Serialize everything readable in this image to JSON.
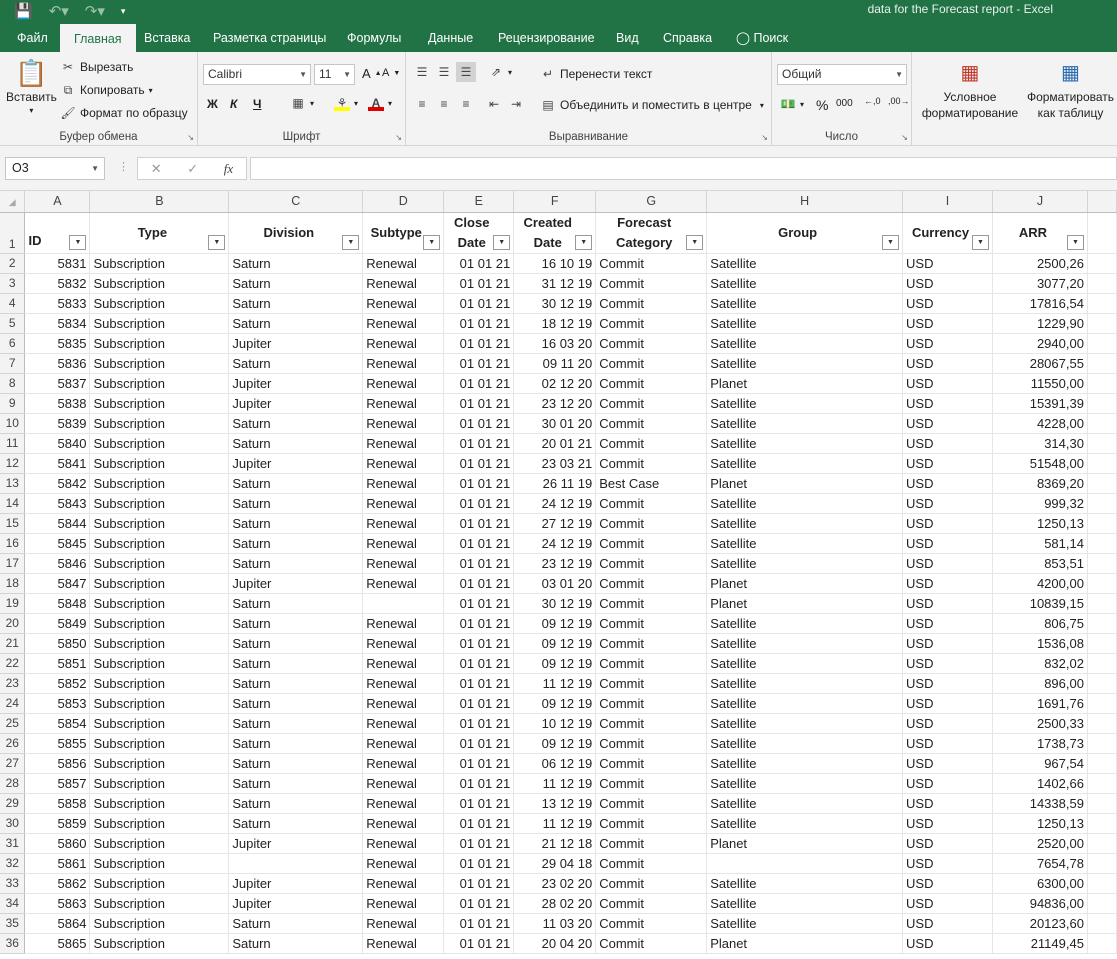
{
  "titlebar": {
    "save_icon": "save-icon",
    "undo_icon": "undo-icon",
    "redo_icon": "redo-icon",
    "title": "data for the Forecast report  -  Excel"
  },
  "tabs": [
    "Файл",
    "Главная",
    "Вставка",
    "Разметка страницы",
    "Формулы",
    "Данные",
    "Рецензирование",
    "Вид",
    "Справка",
    "Поиск"
  ],
  "ribbon": {
    "clipboard": {
      "paste": "Вставить",
      "cut": "Вырезать",
      "copy": "Копировать",
      "format_painter": "Формат по образцу",
      "label": "Буфер обмена"
    },
    "font": {
      "name": "Calibri",
      "size": "11",
      "bold": "Ж",
      "italic": "К",
      "underline": "Ч",
      "label": "Шрифт"
    },
    "alignment": {
      "wrap": "Перенести текст",
      "merge": "Объединить и поместить в центре",
      "label": "Выравнивание"
    },
    "number": {
      "format": "Общий",
      "percent": "%",
      "thousands": "000",
      "label": "Число"
    },
    "styles": {
      "conditional": "Условное форматирование",
      "table": "Форматировать как таблицу"
    }
  },
  "formula_bar": {
    "name_box": "O3",
    "cancel": "✕",
    "enter": "✓",
    "fx": "fx",
    "value": ""
  },
  "columns": [
    "A",
    "B",
    "C",
    "D",
    "E",
    "F",
    "G",
    "H",
    "I",
    "J"
  ],
  "headers": {
    "A": "ID",
    "B": "Type",
    "C": "Division",
    "D": "Subtype",
    "E1": "Close",
    "E2": "Date",
    "F1": "Created",
    "F2": "Date",
    "G1": "Forecast",
    "G2": "Category",
    "H": "Group",
    "I": "Currency",
    "J": "ARR"
  },
  "rows": [
    [
      "2",
      "5831",
      "Subscription",
      "Saturn",
      "Renewal",
      "01 01 21",
      "16 10 19",
      "Commit",
      "Satellite",
      "USD",
      "2500,26"
    ],
    [
      "3",
      "5832",
      "Subscription",
      "Saturn",
      "Renewal",
      "01 01 21",
      "31 12 19",
      "Commit",
      "Satellite",
      "USD",
      "3077,20"
    ],
    [
      "4",
      "5833",
      "Subscription",
      "Saturn",
      "Renewal",
      "01 01 21",
      "30 12 19",
      "Commit",
      "Satellite",
      "USD",
      "17816,54"
    ],
    [
      "5",
      "5834",
      "Subscription",
      "Saturn",
      "Renewal",
      "01 01 21",
      "18 12 19",
      "Commit",
      "Satellite",
      "USD",
      "1229,90"
    ],
    [
      "6",
      "5835",
      "Subscription",
      "Jupiter",
      "Renewal",
      "01 01 21",
      "16 03 20",
      "Commit",
      "Satellite",
      "USD",
      "2940,00"
    ],
    [
      "7",
      "5836",
      "Subscription",
      "Saturn",
      "Renewal",
      "01 01 21",
      "09 11 20",
      "Commit",
      "Satellite",
      "USD",
      "28067,55"
    ],
    [
      "8",
      "5837",
      "Subscription",
      "Jupiter",
      "Renewal",
      "01 01 21",
      "02 12 20",
      "Commit",
      "Planet",
      "USD",
      "11550,00"
    ],
    [
      "9",
      "5838",
      "Subscription",
      "Jupiter",
      "Renewal",
      "01 01 21",
      "23 12 20",
      "Commit",
      "Satellite",
      "USD",
      "15391,39"
    ],
    [
      "10",
      "5839",
      "Subscription",
      "Saturn",
      "Renewal",
      "01 01 21",
      "30 01 20",
      "Commit",
      "Satellite",
      "USD",
      "4228,00"
    ],
    [
      "11",
      "5840",
      "Subscription",
      "Saturn",
      "Renewal",
      "01 01 21",
      "20 01 21",
      "Commit",
      "Satellite",
      "USD",
      "314,30"
    ],
    [
      "12",
      "5841",
      "Subscription",
      "Jupiter",
      "Renewal",
      "01 01 21",
      "23 03 21",
      "Commit",
      "Satellite",
      "USD",
      "51548,00"
    ],
    [
      "13",
      "5842",
      "Subscription",
      "Saturn",
      "Renewal",
      "01 01 21",
      "26 11 19",
      "Best Case",
      "Planet",
      "USD",
      "8369,20"
    ],
    [
      "14",
      "5843",
      "Subscription",
      "Saturn",
      "Renewal",
      "01 01 21",
      "24 12 19",
      "Commit",
      "Satellite",
      "USD",
      "999,32"
    ],
    [
      "15",
      "5844",
      "Subscription",
      "Saturn",
      "Renewal",
      "01 01 21",
      "27 12 19",
      "Commit",
      "Satellite",
      "USD",
      "1250,13"
    ],
    [
      "16",
      "5845",
      "Subscription",
      "Saturn",
      "Renewal",
      "01 01 21",
      "24 12 19",
      "Commit",
      "Satellite",
      "USD",
      "581,14"
    ],
    [
      "17",
      "5846",
      "Subscription",
      "Saturn",
      "Renewal",
      "01 01 21",
      "23 12 19",
      "Commit",
      "Satellite",
      "USD",
      "853,51"
    ],
    [
      "18",
      "5847",
      "Subscription",
      "Jupiter",
      "Renewal",
      "01 01 21",
      "03 01 20",
      "Commit",
      "Planet",
      "USD",
      "4200,00"
    ],
    [
      "19",
      "5848",
      "Subscription",
      "Saturn",
      "",
      "01 01 21",
      "30 12 19",
      "Commit",
      "Planet",
      "USD",
      "10839,15"
    ],
    [
      "20",
      "5849",
      "Subscription",
      "Saturn",
      "Renewal",
      "01 01 21",
      "09 12 19",
      "Commit",
      "Satellite",
      "USD",
      "806,75"
    ],
    [
      "21",
      "5850",
      "Subscription",
      "Saturn",
      "Renewal",
      "01 01 21",
      "09 12 19",
      "Commit",
      "Satellite",
      "USD",
      "1536,08"
    ],
    [
      "22",
      "5851",
      "Subscription",
      "Saturn",
      "Renewal",
      "01 01 21",
      "09 12 19",
      "Commit",
      "Satellite",
      "USD",
      "832,02"
    ],
    [
      "23",
      "5852",
      "Subscription",
      "Saturn",
      "Renewal",
      "01 01 21",
      "11 12 19",
      "Commit",
      "Satellite",
      "USD",
      "896,00"
    ],
    [
      "24",
      "5853",
      "Subscription",
      "Saturn",
      "Renewal",
      "01 01 21",
      "09 12 19",
      "Commit",
      "Satellite",
      "USD",
      "1691,76"
    ],
    [
      "25",
      "5854",
      "Subscription",
      "Saturn",
      "Renewal",
      "01 01 21",
      "10 12 19",
      "Commit",
      "Satellite",
      "USD",
      "2500,33"
    ],
    [
      "26",
      "5855",
      "Subscription",
      "Saturn",
      "Renewal",
      "01 01 21",
      "09 12 19",
      "Commit",
      "Satellite",
      "USD",
      "1738,73"
    ],
    [
      "27",
      "5856",
      "Subscription",
      "Saturn",
      "Renewal",
      "01 01 21",
      "06 12 19",
      "Commit",
      "Satellite",
      "USD",
      "967,54"
    ],
    [
      "28",
      "5857",
      "Subscription",
      "Saturn",
      "Renewal",
      "01 01 21",
      "11 12 19",
      "Commit",
      "Satellite",
      "USD",
      "1402,66"
    ],
    [
      "29",
      "5858",
      "Subscription",
      "Saturn",
      "Renewal",
      "01 01 21",
      "13 12 19",
      "Commit",
      "Satellite",
      "USD",
      "14338,59"
    ],
    [
      "30",
      "5859",
      "Subscription",
      "Saturn",
      "Renewal",
      "01 01 21",
      "11 12 19",
      "Commit",
      "Satellite",
      "USD",
      "1250,13"
    ],
    [
      "31",
      "5860",
      "Subscription",
      "Jupiter",
      "Renewal",
      "01 01 21",
      "21 12 18",
      "Commit",
      "Planet",
      "USD",
      "2520,00"
    ],
    [
      "32",
      "5861",
      "Subscription",
      "",
      "Renewal",
      "01 01 21",
      "29 04 18",
      "Commit",
      "",
      "USD",
      "7654,78"
    ],
    [
      "33",
      "5862",
      "Subscription",
      "Jupiter",
      "Renewal",
      "01 01 21",
      "23 02 20",
      "Commit",
      "Satellite",
      "USD",
      "6300,00"
    ],
    [
      "34",
      "5863",
      "Subscription",
      "Jupiter",
      "Renewal",
      "01 01 21",
      "28 02 20",
      "Commit",
      "Satellite",
      "USD",
      "94836,00"
    ],
    [
      "35",
      "5864",
      "Subscription",
      "Saturn",
      "Renewal",
      "01 01 21",
      "11 03 20",
      "Commit",
      "Satellite",
      "USD",
      "20123,60"
    ],
    [
      "36",
      "5865",
      "Subscription",
      "Saturn",
      "Renewal",
      "01 01 21",
      "20 04 20",
      "Commit",
      "Planet",
      "USD",
      "21149,45"
    ]
  ],
  "colors": {
    "accent": "#217346",
    "ribbon_bg": "#f3f3f3",
    "header_bg": "#f3f3f3"
  }
}
